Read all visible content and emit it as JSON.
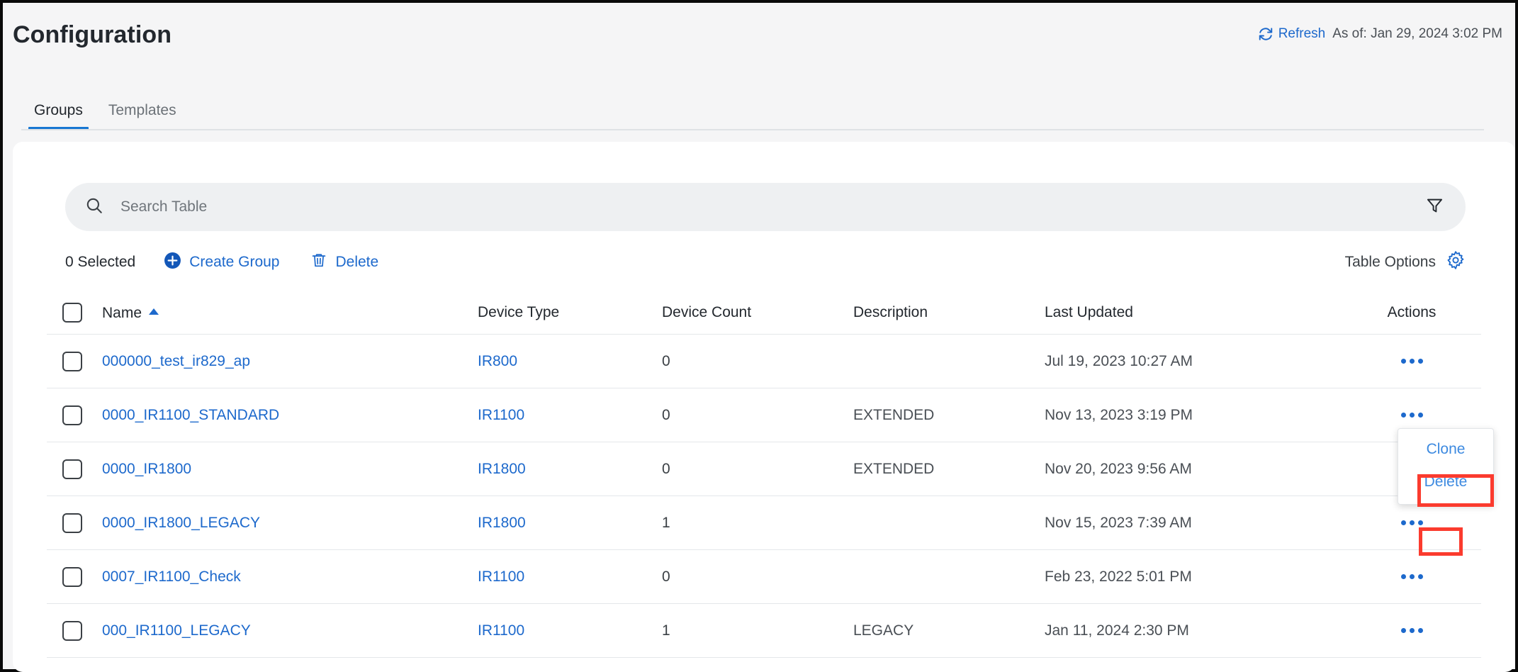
{
  "header": {
    "title": "Configuration",
    "refresh_label": "Refresh",
    "as_of": "As of: Jan 29, 2024 3:02 PM",
    "refresh_icon": "refresh-icon"
  },
  "tabs": [
    {
      "label": "Groups",
      "active": true
    },
    {
      "label": "Templates",
      "active": false
    }
  ],
  "search": {
    "placeholder": "Search Table",
    "value": "",
    "search_icon": "search-icon",
    "filter_icon": "filter-icon"
  },
  "toolbar": {
    "selected_count": "0 Selected",
    "create_group_label": "Create Group",
    "delete_label": "Delete",
    "table_options_label": "Table Options",
    "plus_icon": "plus-circle-icon",
    "trash_icon": "trash-icon",
    "gear_icon": "gear-icon"
  },
  "table": {
    "columns": [
      "Name",
      "Device Type",
      "Device Count",
      "Description",
      "Last Updated",
      "Actions"
    ],
    "sort": {
      "column": "Name",
      "direction": "asc",
      "glyph": "▲"
    },
    "rows": [
      {
        "name": "000000_test_ir829_ap",
        "device_type": "IR800",
        "device_count": "0",
        "description": "",
        "last_updated": "Jul 19, 2023 10:27 AM"
      },
      {
        "name": "0000_IR1100_STANDARD",
        "device_type": "IR1100",
        "device_count": "0",
        "description": "EXTENDED",
        "last_updated": "Nov 13, 2023 3:19 PM"
      },
      {
        "name": "0000_IR1800",
        "device_type": "IR1800",
        "device_count": "0",
        "description": "EXTENDED",
        "last_updated": "Nov 20, 2023 9:56 AM"
      },
      {
        "name": "0000_IR1800_LEGACY",
        "device_type": "IR1800",
        "device_count": "1",
        "description": "",
        "last_updated": "Nov 15, 2023 7:39 AM"
      },
      {
        "name": "0007_IR1100_Check",
        "device_type": "IR1100",
        "device_count": "0",
        "description": "",
        "last_updated": "Feb 23, 2022 5:01 PM"
      },
      {
        "name": "000_IR1100_LEGACY",
        "device_type": "IR1100",
        "device_count": "1",
        "description": "LEGACY",
        "last_updated": "Jan 11, 2024 2:30 PM"
      }
    ]
  },
  "action_menu": {
    "open": true,
    "items": [
      {
        "label": "Clone",
        "highlighted": false
      },
      {
        "label": "Delete",
        "highlighted": true
      }
    ]
  },
  "colors": {
    "link_blue": "#1d69cc",
    "accent_blue": "#1776d2",
    "annotation_red": "#fb3b2e",
    "page_bg": "#f5f5f6",
    "card_bg": "#ffffff",
    "search_bg": "#eef0f2",
    "text_dark": "#23282e"
  }
}
